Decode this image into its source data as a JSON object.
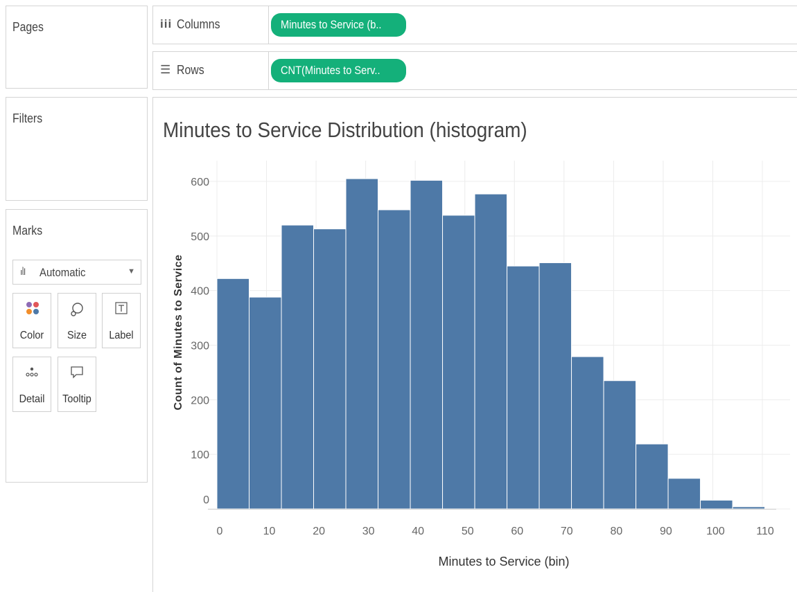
{
  "shelves": {
    "pages_label": "Pages",
    "filters_label": "Filters",
    "columns": {
      "label": "Columns",
      "icon": "columns-icon",
      "pill": "Minutes to Service (b.."
    },
    "rows": {
      "label": "Rows",
      "icon": "rows-icon",
      "pill": "CNT(Minutes to Serv.."
    }
  },
  "marks": {
    "title": "Marks",
    "type_label": "Automatic",
    "type_icon": "bar-chart-icon",
    "buttons": {
      "color": "Color",
      "size": "Size",
      "label": "Label",
      "detail": "Detail",
      "tooltip": "Tooltip"
    }
  },
  "colors": {
    "pill": "#14b07a",
    "bar": "#4e79a7",
    "grid": "#ececec"
  },
  "chart_data": {
    "type": "bar",
    "title": "Minutes to Service Distribution (histogram)",
    "xlabel": "Minutes to Service (bin)",
    "ylabel": "Count of Minutes to Service",
    "categories": [
      "0",
      "6.5",
      "13",
      "19.5",
      "26",
      "32.5",
      "39",
      "45.5",
      "52",
      "58.5",
      "65",
      "71.5",
      "78",
      "84.5",
      "91",
      "97.5",
      "104"
    ],
    "bin_width": 6.5,
    "values": [
      422,
      388,
      520,
      513,
      605,
      548,
      602,
      538,
      577,
      445,
      451,
      279,
      235,
      119,
      56,
      16,
      4
    ],
    "x_ticks": [
      "0",
      "10",
      "20",
      "30",
      "40",
      "50",
      "60",
      "70",
      "80",
      "90",
      "100",
      "110"
    ],
    "y_ticks": [
      "0",
      "100",
      "200",
      "300",
      "400",
      "500",
      "600"
    ],
    "xlim": [
      0,
      110
    ],
    "ylim": [
      0,
      600
    ],
    "grid": true
  }
}
